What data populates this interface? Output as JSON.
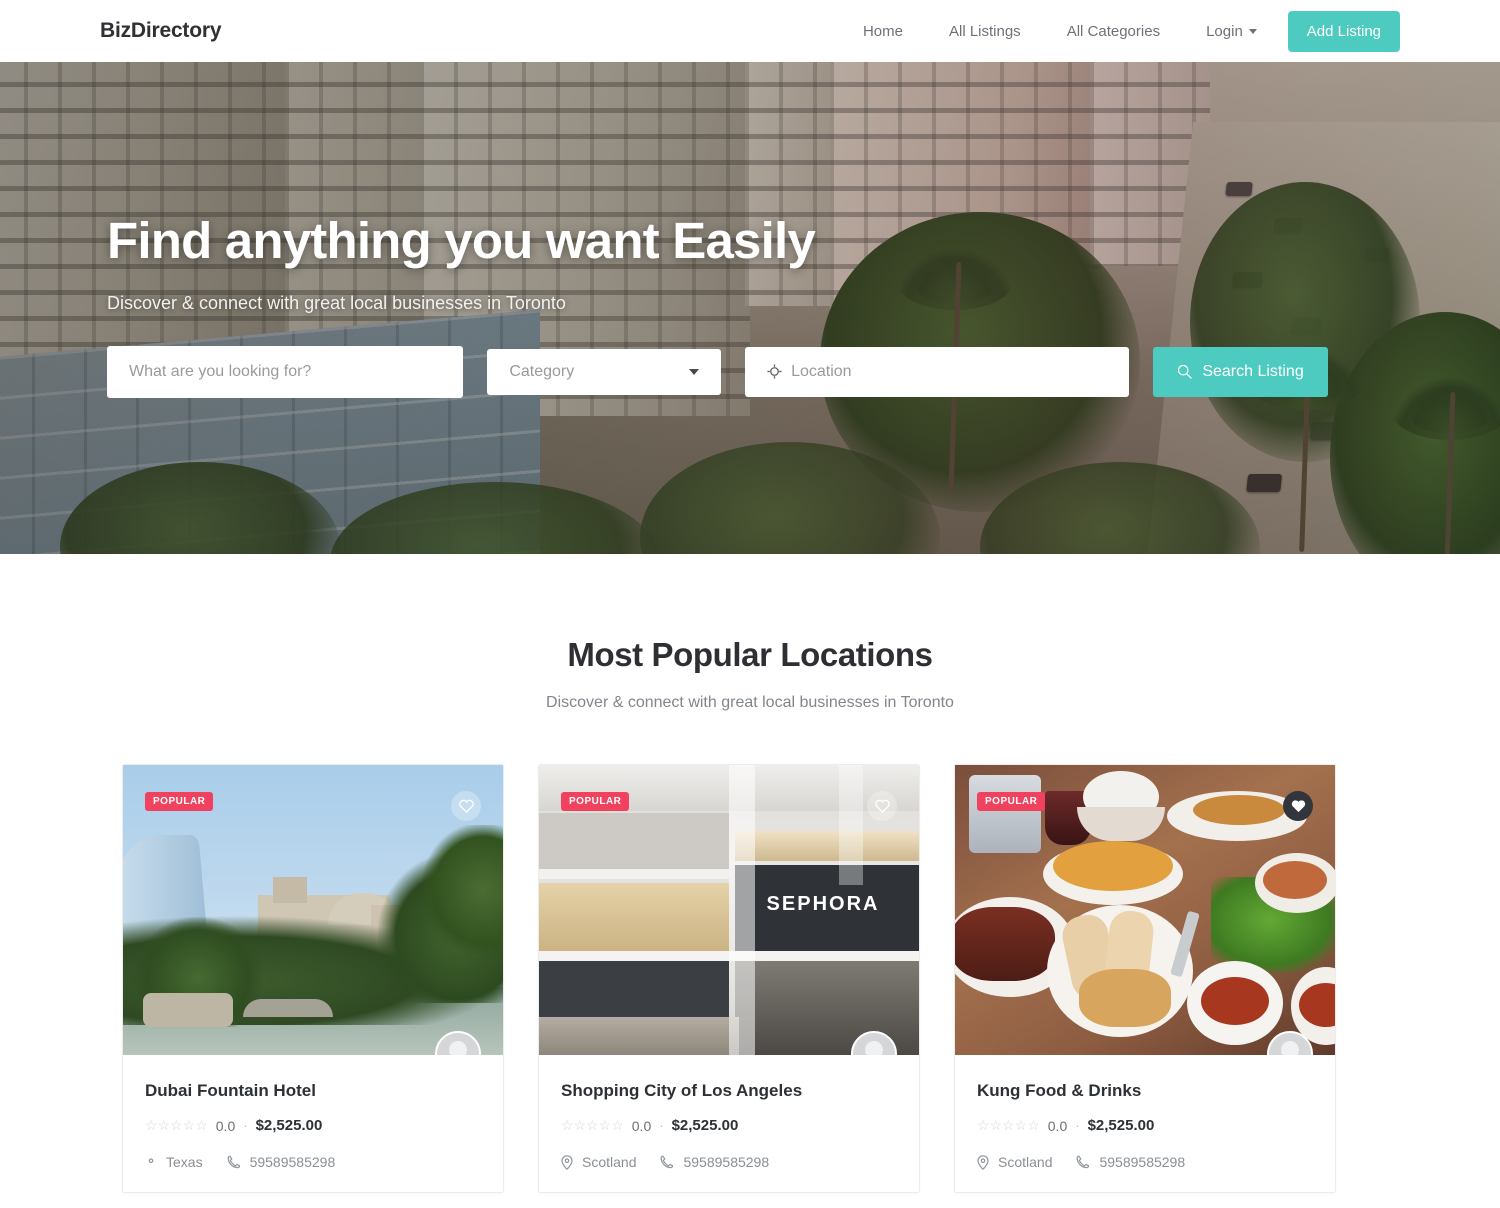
{
  "header": {
    "brand": "BizDirectory",
    "nav": [
      {
        "label": "Home"
      },
      {
        "label": "All Listings"
      },
      {
        "label": "All Categories"
      },
      {
        "label": "Login",
        "caret": true
      }
    ],
    "cta_label": "Add Listing"
  },
  "hero": {
    "title": "Find anything you want Easily",
    "subtitle": "Discover & connect with great local businesses in Toronto",
    "search": {
      "keyword_placeholder": "What are you looking for?",
      "category_label": "Category",
      "location_placeholder": "Location",
      "button_label": "Search Listing",
      "search_icon": "magnifier-icon",
      "location_icon": "location-crosshair-icon",
      "chevron_icon": "chevron-down-icon"
    }
  },
  "section": {
    "title": "Most Popular Locations",
    "subtitle": "Discover & connect with great local businesses in Toronto"
  },
  "cards": [
    {
      "badge": "POPULAR",
      "title": "Dubai Fountain Hotel",
      "rating": "0.0",
      "separator": "·",
      "price": "$2,525.00",
      "location": "Texas",
      "phone": "59589585298",
      "favorited": false,
      "stars": "☆☆☆☆☆"
    },
    {
      "badge": "POPULAR",
      "title": "Shopping City of Los Angeles",
      "rating": "0.0",
      "separator": "·",
      "price": "$2,525.00",
      "location": "Scotland",
      "phone": "59589585298",
      "favorited": false,
      "stars": "☆☆☆☆☆"
    },
    {
      "badge": "POPULAR",
      "title": "Kung Food & Drinks",
      "rating": "0.0",
      "separator": "·",
      "price": "$2,525.00",
      "location": "Scotland",
      "phone": "59589585298",
      "favorited": true,
      "stars": "☆☆☆☆☆"
    }
  ],
  "colors": {
    "accent_teal": "#4ecbc1",
    "badge_pink": "#f0425e",
    "text_dark": "#2d3034",
    "text_muted": "#8a8f94"
  }
}
